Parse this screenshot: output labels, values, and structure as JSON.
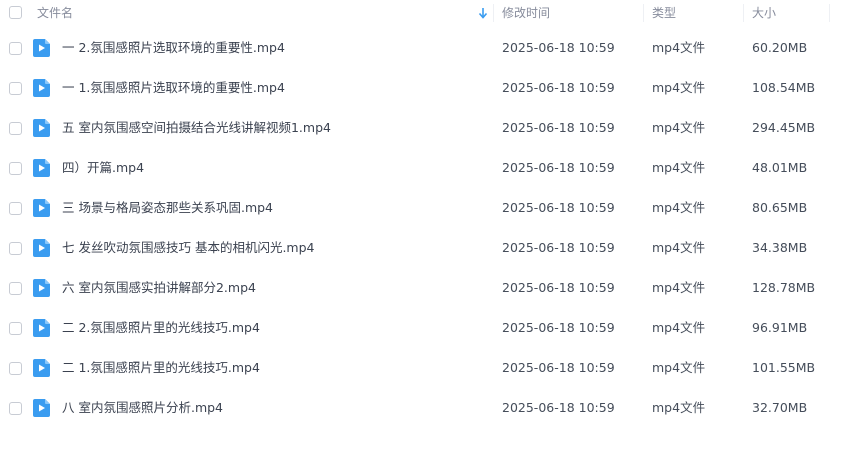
{
  "header": {
    "name_label": "文件名",
    "time_label": "修改时间",
    "type_label": "类型",
    "size_label": "大小",
    "sort_icon": "arrow-down-icon"
  },
  "colors": {
    "icon_blue": "#3a9cf0",
    "text": "#454d5a",
    "header_text": "#878c9c",
    "checkbox_border": "#c8ccd4"
  },
  "files": [
    {
      "name": "一 2.氛围感照片选取环境的重要性.mp4",
      "time": "2025-06-18 10:59",
      "type": "mp4文件",
      "size": "60.20MB",
      "icon": "video-file-icon"
    },
    {
      "name": "一 1.氛围感照片选取环境的重要性.mp4",
      "time": "2025-06-18 10:59",
      "type": "mp4文件",
      "size": "108.54MB",
      "icon": "video-file-icon"
    },
    {
      "name": "五 室内氛围感空间拍摄结合光线讲解视频1.mp4",
      "time": "2025-06-18 10:59",
      "type": "mp4文件",
      "size": "294.45MB",
      "icon": "video-file-icon"
    },
    {
      "name": "四）开篇.mp4",
      "time": "2025-06-18 10:59",
      "type": "mp4文件",
      "size": "48.01MB",
      "icon": "video-file-icon"
    },
    {
      "name": "三 场景与格局姿态那些关系巩固.mp4",
      "time": "2025-06-18 10:59",
      "type": "mp4文件",
      "size": "80.65MB",
      "icon": "video-file-icon"
    },
    {
      "name": "七 发丝吹动氛围感技巧 基本的相机闪光.mp4",
      "time": "2025-06-18 10:59",
      "type": "mp4文件",
      "size": "34.38MB",
      "icon": "video-file-icon"
    },
    {
      "name": "六 室内氛围感实拍讲解部分2.mp4",
      "time": "2025-06-18 10:59",
      "type": "mp4文件",
      "size": "128.78MB",
      "icon": "video-file-icon"
    },
    {
      "name": "二 2.氛围感照片里的光线技巧.mp4",
      "time": "2025-06-18 10:59",
      "type": "mp4文件",
      "size": "96.91MB",
      "icon": "video-file-icon"
    },
    {
      "name": "二 1.氛围感照片里的光线技巧.mp4",
      "time": "2025-06-18 10:59",
      "type": "mp4文件",
      "size": "101.55MB",
      "icon": "video-file-icon"
    },
    {
      "name": "八 室内氛围感照片分析.mp4",
      "time": "2025-06-18 10:59",
      "type": "mp4文件",
      "size": "32.70MB",
      "icon": "video-file-icon"
    }
  ]
}
